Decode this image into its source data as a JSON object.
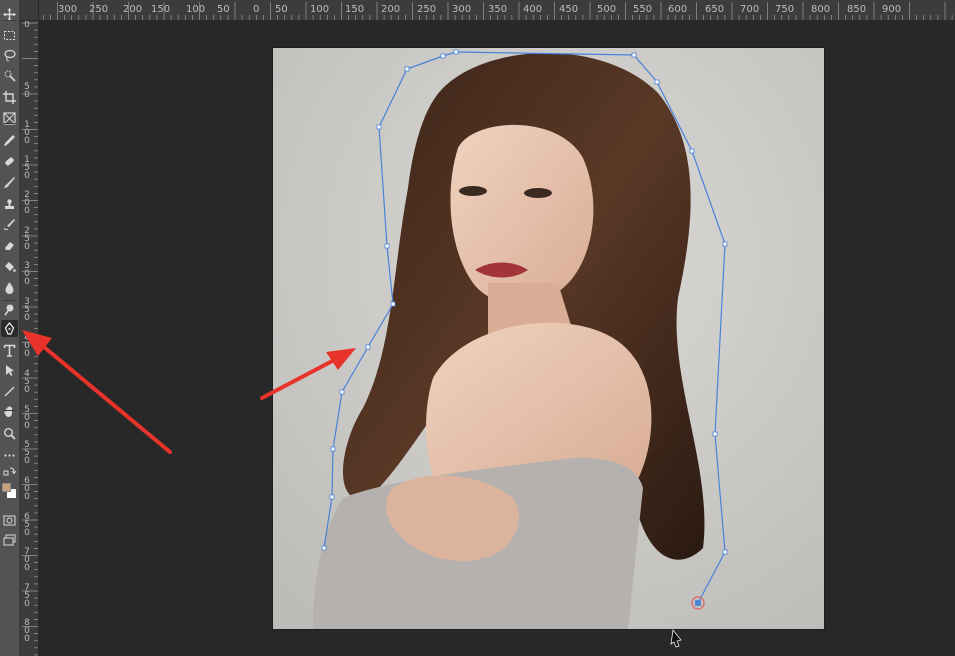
{
  "toolbar": {
    "tools": [
      {
        "name": "move-tool-icon"
      },
      {
        "name": "marquee-tool-icon"
      },
      {
        "name": "lasso-tool-icon"
      },
      {
        "name": "quick-select-tool-icon"
      },
      {
        "name": "crop-tool-icon"
      },
      {
        "name": "frame-tool-icon"
      },
      {
        "name": "eyedropper-tool-icon"
      },
      {
        "name": "healing-brush-tool-icon"
      },
      {
        "name": "brush-tool-icon"
      },
      {
        "name": "clone-stamp-tool-icon"
      },
      {
        "name": "history-brush-tool-icon"
      },
      {
        "name": "eraser-tool-icon"
      },
      {
        "name": "paint-bucket-tool-icon"
      },
      {
        "name": "blur-tool-icon"
      },
      {
        "name": "dodge-tool-icon"
      },
      {
        "name": "pen-tool-icon",
        "active": true
      },
      {
        "name": "type-tool-icon"
      },
      {
        "name": "path-selection-tool-icon"
      },
      {
        "name": "line-tool-icon"
      },
      {
        "name": "hand-tool-icon"
      },
      {
        "name": "zoom-tool-icon"
      },
      {
        "name": "more-tools-icon"
      }
    ],
    "foreground_color": "#c8a07a",
    "background_color": "#ffffff"
  },
  "ruler_top": {
    "labels": [
      "300",
      "250",
      "200",
      "150",
      "100",
      "50",
      "0",
      "50",
      "100",
      "150",
      "200",
      "250",
      "300",
      "350",
      "400",
      "450",
      "500",
      "550",
      "600",
      "650",
      "700",
      "750",
      "800",
      "850",
      "900"
    ]
  },
  "ruler_left": {
    "labels": [
      "0",
      "50",
      "100",
      "150",
      "200",
      "250",
      "300",
      "350",
      "400",
      "450",
      "500",
      "550",
      "600",
      "650",
      "700",
      "750",
      "800"
    ]
  },
  "colors": {
    "path_stroke": "#4a82d8",
    "annotation_arrow": "#e8332a",
    "workspace": "#282828",
    "toolbar": "#535353",
    "ruler": "#3c3c3c"
  }
}
